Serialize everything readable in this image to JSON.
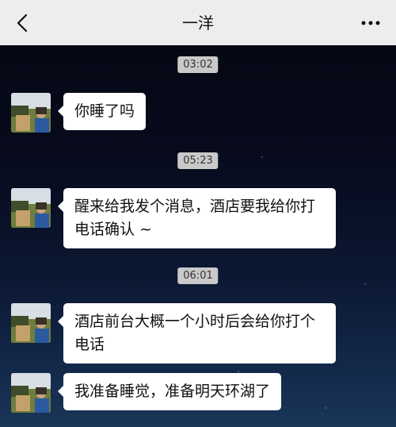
{
  "header": {
    "title": "一洋"
  },
  "chat": {
    "messages": [
      {
        "time": "03:02",
        "text": "你睡了吗"
      },
      {
        "time": "05:23",
        "text": "醒来给我发个消息，酒店要我给你打电话确认 ~"
      },
      {
        "time": "06:01",
        "text": "酒店前台大概一个小时后会给你打个电话"
      },
      {
        "time": "",
        "text": "我准备睡觉，准备明天环湖了"
      }
    ]
  },
  "colors": {
    "header_bg": "#ededed",
    "bubble_bg": "#ffffff",
    "time_badge_bg": "#c9c9c9",
    "chat_bg_top": "#050814",
    "chat_bg_bottom": "#1a3658"
  }
}
